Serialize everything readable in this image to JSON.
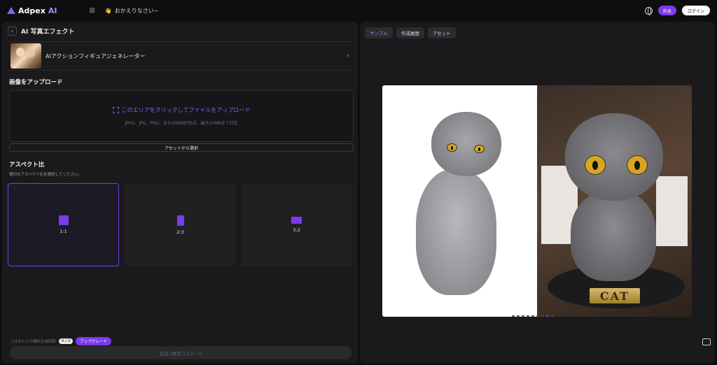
{
  "header": {
    "logo_main": "Adpex",
    "logo_ai": "AI",
    "sidebar_icon": "sidebar-toggle-icon",
    "greeting_emoji": "👋",
    "greeting": "おかえりなさい~",
    "pricing_label": "料金",
    "login_label": "ログイン"
  },
  "left": {
    "title": "AI 写真エフェクト",
    "tool_name": "AIアクションフィギュアジェネレーター",
    "upload_heading": "画像をアップロード",
    "upload_main": "このエリアをクリックしてファイルをアップロード",
    "upload_sub": "JPEG、JPG、PNG、またはWEBP形式、最大10MBまで対応",
    "asset_select": "アセットから選択",
    "aspect_heading": "アスペクト比",
    "aspect_sub": "適切なアスペクト比を選択してください。",
    "aspect_options": [
      {
        "label": "1:1",
        "selected": true
      },
      {
        "label": "2:3",
        "selected": false
      },
      {
        "label": "3:2",
        "selected": false
      }
    ],
    "quota_text": "1日あたりの無料生成回数",
    "quota_value": "0 / 2",
    "upgrade_label": "アップグレード",
    "generate_label": "生成 (推定コスト: ?)"
  },
  "right": {
    "tabs": [
      {
        "label": "サンプル",
        "active": true
      },
      {
        "label": "作成履歴",
        "active": false
      },
      {
        "label": "アセット",
        "active": false
      }
    ],
    "plaque_text": "CAT",
    "carousel_count": 9,
    "carousel_active": 7
  },
  "colors": {
    "accent": "#7c3aed",
    "panel": "#1a1a1c",
    "background": "#0e0e0f"
  }
}
